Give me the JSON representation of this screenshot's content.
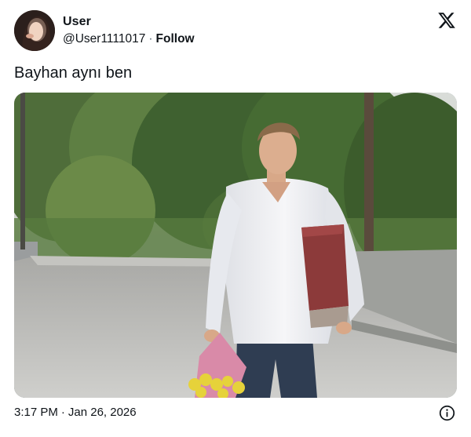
{
  "user": {
    "name": "User",
    "handle": "@User1111017",
    "separator": "·",
    "follow_label": "Follow"
  },
  "tweet": {
    "text": "Bayhan aynı ben"
  },
  "meta": {
    "time": "3:17 PM",
    "separator": "·",
    "date": "Jan 26, 2026"
  },
  "icons": {
    "brand": "x-logo-icon",
    "info": "info-icon"
  },
  "colors": {
    "text": "#0f1419",
    "secondary": "#536471",
    "background": "#ffffff"
  }
}
